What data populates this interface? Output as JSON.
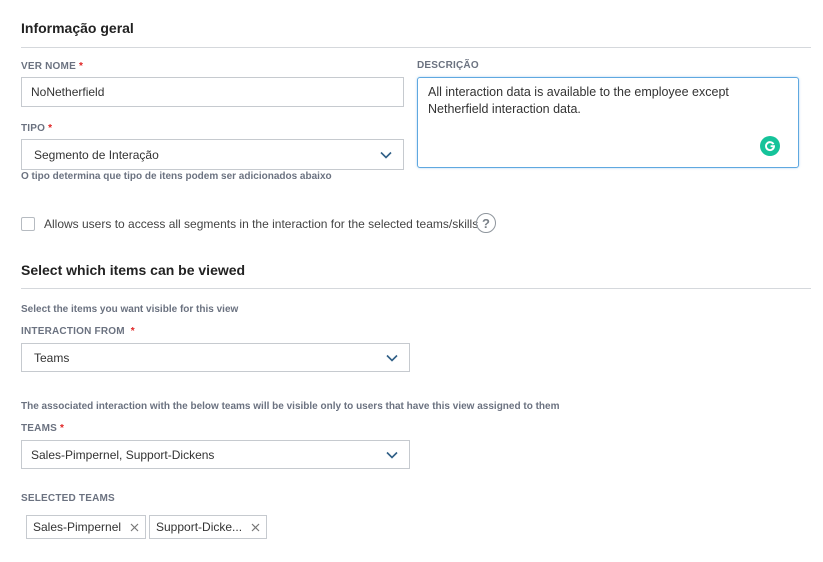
{
  "general": {
    "title": "Informação geral",
    "view_name_label": "VER NOME",
    "view_name_value": "NoNetherfield",
    "type_label": "TIPO",
    "type_value": "Segmento de Interação",
    "type_hint": "O tipo determina que tipo de itens podem ser adicionados abaixo",
    "description_label": "DESCRIÇÃO",
    "description_value": "All interaction data is available to the employee except Netherfield interaction data.",
    "required_mark": "*"
  },
  "access": {
    "checkbox_label": "Allows users to access all segments in the interaction for the selected teams/skills",
    "help_symbol": "?"
  },
  "items": {
    "title": "Select which items can be viewed",
    "hint": "Select the items you want visible for this view",
    "interaction_from_label": "INTERACTION FROM",
    "interaction_from_value": "Teams",
    "teams_hint": "The associated interaction with the below teams will be visible only to users that have this view assigned to them",
    "teams_label": "TEAMS",
    "teams_value": "Sales-Pimpernel, Support-Dickens",
    "selected_teams_label": "SELECTED TEAMS",
    "selected_teams": [
      "Sales-Pimpernel",
      "Support-Dicke..."
    ]
  },
  "icons": {
    "chevron": "chevron-down-icon",
    "remove": "close-icon",
    "grammarly": "grammarly-icon",
    "help": "help-icon"
  },
  "colors": {
    "required": "#e02424",
    "focus_border": "#5fa8e0",
    "grammarly": "#15c39a"
  }
}
